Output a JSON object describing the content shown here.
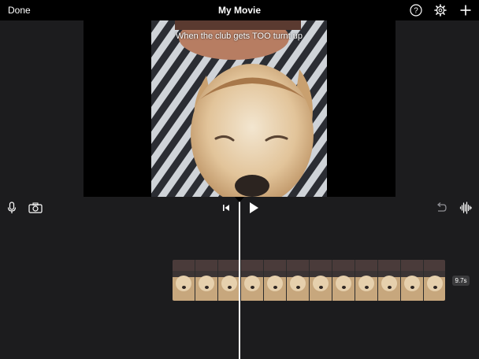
{
  "header": {
    "done_label": "Done",
    "title": "My Movie"
  },
  "header_icons": [
    "help-icon",
    "settings-gear-icon",
    "add-plus-icon"
  ],
  "preview": {
    "caption": "When the club gets TOO turnt up"
  },
  "controls": {
    "left_icons": [
      "microphone-icon",
      "camera-icon"
    ],
    "center_icons": [
      "skip-to-start-icon",
      "play-icon"
    ],
    "right_icons": [
      "undo-icon",
      "audio-waveform-icon"
    ]
  },
  "timeline": {
    "clip_frame_count": 12,
    "duration_label": "9.7s"
  }
}
